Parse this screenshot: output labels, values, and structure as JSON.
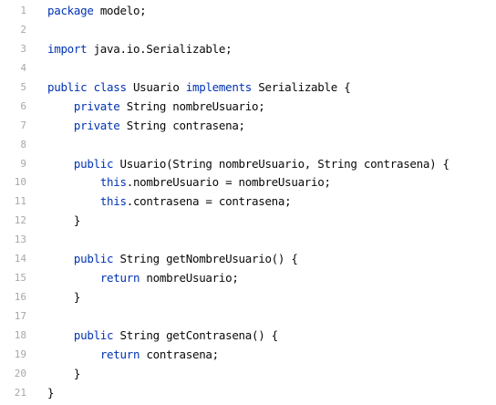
{
  "editor": {
    "language": "java",
    "colors": {
      "background": "#ffffff",
      "keyword": "#0033b3",
      "identifier": "#080808",
      "line_number": "#a8a8a8"
    },
    "lines": [
      {
        "number": "1",
        "tokens": [
          {
            "t": "package",
            "k": "kw"
          },
          {
            "t": " modelo;",
            "k": "id"
          }
        ]
      },
      {
        "number": "2",
        "tokens": []
      },
      {
        "number": "3",
        "tokens": [
          {
            "t": "import",
            "k": "kw"
          },
          {
            "t": " java.io.Serializable;",
            "k": "id"
          }
        ]
      },
      {
        "number": "4",
        "tokens": []
      },
      {
        "number": "5",
        "tokens": [
          {
            "t": "public",
            "k": "kw"
          },
          {
            "t": " ",
            "k": "id"
          },
          {
            "t": "class",
            "k": "kw"
          },
          {
            "t": " Usuario ",
            "k": "id"
          },
          {
            "t": "implements",
            "k": "kw"
          },
          {
            "t": " Serializable {",
            "k": "id"
          }
        ]
      },
      {
        "number": "6",
        "tokens": [
          {
            "t": "    ",
            "k": "id"
          },
          {
            "t": "private",
            "k": "kw"
          },
          {
            "t": " String nombreUsuario;",
            "k": "id"
          }
        ]
      },
      {
        "number": "7",
        "tokens": [
          {
            "t": "    ",
            "k": "id"
          },
          {
            "t": "private",
            "k": "kw"
          },
          {
            "t": " String contrasena;",
            "k": "id"
          }
        ]
      },
      {
        "number": "8",
        "tokens": []
      },
      {
        "number": "9",
        "tokens": [
          {
            "t": "    ",
            "k": "id"
          },
          {
            "t": "public",
            "k": "kw"
          },
          {
            "t": " Usuario(String nombreUsuario, String contrasena) {",
            "k": "id"
          }
        ]
      },
      {
        "number": "10",
        "tokens": [
          {
            "t": "        ",
            "k": "id"
          },
          {
            "t": "this",
            "k": "kw"
          },
          {
            "t": ".nombreUsuario = nombreUsuario;",
            "k": "id"
          }
        ]
      },
      {
        "number": "11",
        "tokens": [
          {
            "t": "        ",
            "k": "id"
          },
          {
            "t": "this",
            "k": "kw"
          },
          {
            "t": ".contrasena = contrasena;",
            "k": "id"
          }
        ]
      },
      {
        "number": "12",
        "tokens": [
          {
            "t": "    }",
            "k": "id"
          }
        ]
      },
      {
        "number": "13",
        "tokens": []
      },
      {
        "number": "14",
        "tokens": [
          {
            "t": "    ",
            "k": "id"
          },
          {
            "t": "public",
            "k": "kw"
          },
          {
            "t": " String getNombreUsuario() {",
            "k": "id"
          }
        ]
      },
      {
        "number": "15",
        "tokens": [
          {
            "t": "        ",
            "k": "id"
          },
          {
            "t": "return",
            "k": "kw"
          },
          {
            "t": " nombreUsuario;",
            "k": "id"
          }
        ]
      },
      {
        "number": "16",
        "tokens": [
          {
            "t": "    }",
            "k": "id"
          }
        ]
      },
      {
        "number": "17",
        "tokens": []
      },
      {
        "number": "18",
        "tokens": [
          {
            "t": "    ",
            "k": "id"
          },
          {
            "t": "public",
            "k": "kw"
          },
          {
            "t": " String getContrasena() {",
            "k": "id"
          }
        ]
      },
      {
        "number": "19",
        "tokens": [
          {
            "t": "        ",
            "k": "id"
          },
          {
            "t": "return",
            "k": "kw"
          },
          {
            "t": " contrasena;",
            "k": "id"
          }
        ]
      },
      {
        "number": "20",
        "tokens": [
          {
            "t": "    }",
            "k": "id"
          }
        ]
      },
      {
        "number": "21",
        "tokens": [
          {
            "t": "}",
            "k": "id"
          }
        ]
      }
    ]
  }
}
